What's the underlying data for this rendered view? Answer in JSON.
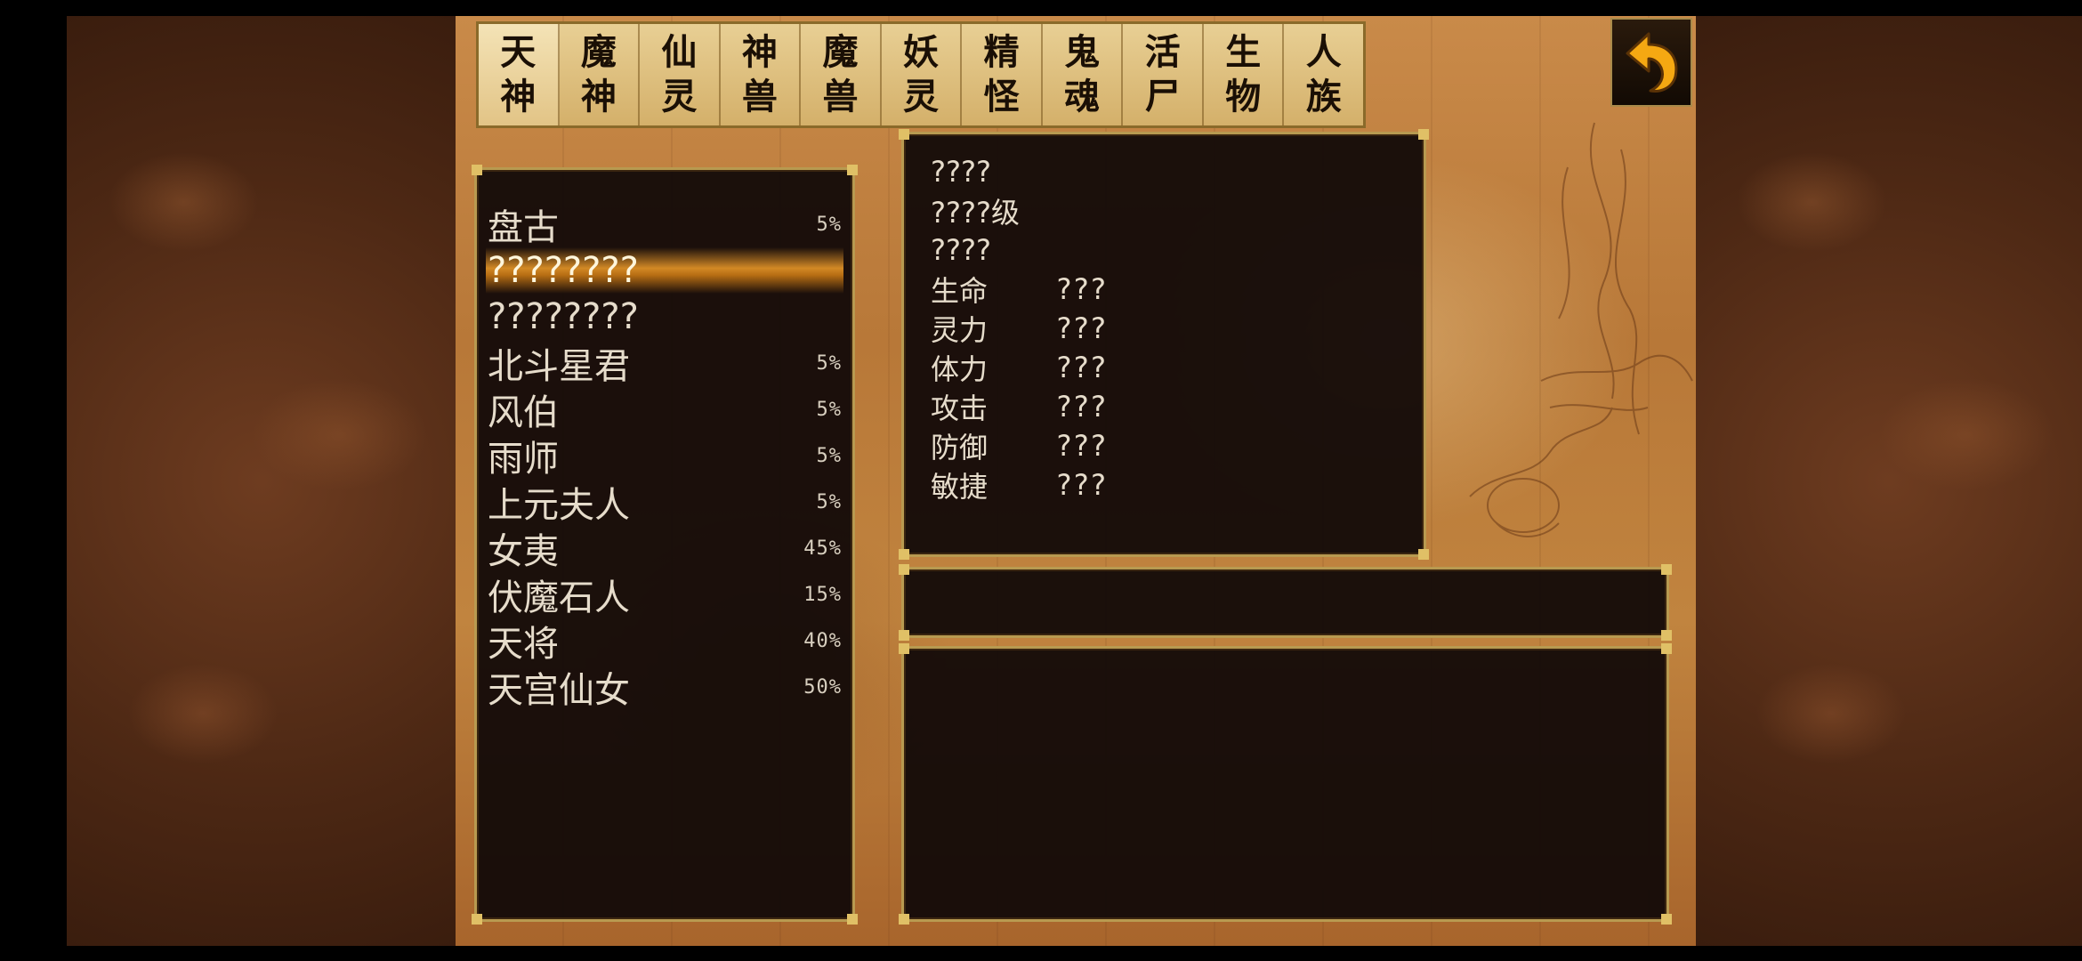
{
  "tabs": [
    {
      "top": "天",
      "bottom": "神",
      "active": true
    },
    {
      "top": "魔",
      "bottom": "神",
      "active": false
    },
    {
      "top": "仙",
      "bottom": "灵",
      "active": false
    },
    {
      "top": "神",
      "bottom": "兽",
      "active": false
    },
    {
      "top": "魔",
      "bottom": "兽",
      "active": false
    },
    {
      "top": "妖",
      "bottom": "灵",
      "active": false
    },
    {
      "top": "精",
      "bottom": "怪",
      "active": false
    },
    {
      "top": "鬼",
      "bottom": "魂",
      "active": false
    },
    {
      "top": "活",
      "bottom": "尸",
      "active": false
    },
    {
      "top": "生",
      "bottom": "物",
      "active": false
    },
    {
      "top": "人",
      "bottom": "族",
      "active": false
    }
  ],
  "back_icon": "back-arrow-icon",
  "accent_color": "#e0c066",
  "list": [
    {
      "name": "盘古",
      "pct": "5%",
      "selected": false
    },
    {
      "name": "????????",
      "pct": "",
      "selected": true
    },
    {
      "name": "????????",
      "pct": "",
      "selected": false
    },
    {
      "name": "北斗星君",
      "pct": "5%",
      "selected": false
    },
    {
      "name": "风伯",
      "pct": "5%",
      "selected": false
    },
    {
      "name": "雨师",
      "pct": "5%",
      "selected": false
    },
    {
      "name": "上元夫人",
      "pct": "5%",
      "selected": false
    },
    {
      "name": "女夷",
      "pct": "45%",
      "selected": false
    },
    {
      "name": "伏魔石人",
      "pct": "15%",
      "selected": false
    },
    {
      "name": "天将",
      "pct": "40%",
      "selected": false
    },
    {
      "name": "天宫仙女",
      "pct": "50%",
      "selected": false
    }
  ],
  "stats": {
    "line1": "????",
    "line2": "????级",
    "line3": "????",
    "rows": [
      {
        "k": "生命",
        "v": "???"
      },
      {
        "k": "灵力",
        "v": "???"
      },
      {
        "k": "体力",
        "v": "???"
      },
      {
        "k": "攻击",
        "v": "???"
      },
      {
        "k": "防御",
        "v": "???"
      },
      {
        "k": "敏捷",
        "v": "???"
      }
    ]
  }
}
